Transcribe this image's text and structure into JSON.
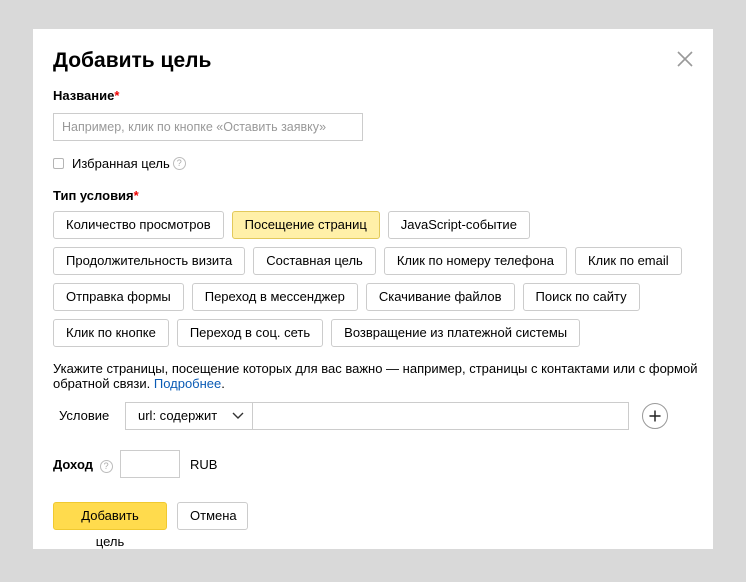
{
  "dialog": {
    "title": "Добавить цель",
    "close_icon": "close-icon"
  },
  "name_field": {
    "label": "Название",
    "required_mark": "*",
    "placeholder": "Например, клик по кнопке «Оставить заявку»",
    "value": ""
  },
  "favorite": {
    "label": "Избранная цель",
    "checked": false,
    "help_icon": "question-icon"
  },
  "condition_type": {
    "label": "Тип условия",
    "required_mark": "*",
    "options": [
      [
        "Количество просмотров",
        "Посещение страниц",
        "JavaScript-событие"
      ],
      [
        "Продолжительность визита",
        "Составная цель",
        "Клик по номеру телефона",
        "Клик по email"
      ],
      [
        "Отправка формы",
        "Переход в мессенджер",
        "Скачивание файлов",
        "Поиск по сайту"
      ],
      [
        "Клик по кнопке",
        "Переход в соц. сеть",
        "Возвращение из платежной системы"
      ]
    ],
    "selected": "Посещение страниц"
  },
  "hint": {
    "text": "Укажите страницы, посещение которых для вас важно — например, страницы с контактами или с формой обратной связи. ",
    "link": "Подробнее",
    "end": "."
  },
  "condition": {
    "label": "Условие",
    "select_value": "url: содержит",
    "input_value": "",
    "add_icon": "plus-icon"
  },
  "income": {
    "label": "Доход",
    "help_icon": "question-icon",
    "value": "",
    "currency": "RUB"
  },
  "actions": {
    "submit": "Добавить цель",
    "cancel": "Отмена"
  },
  "colors": {
    "overlay": "#d9d9d9",
    "selected_chip": "#fff0a8",
    "primary_button": "#ffdb4d",
    "link": "#0a5bb5",
    "required": "#e00000"
  }
}
